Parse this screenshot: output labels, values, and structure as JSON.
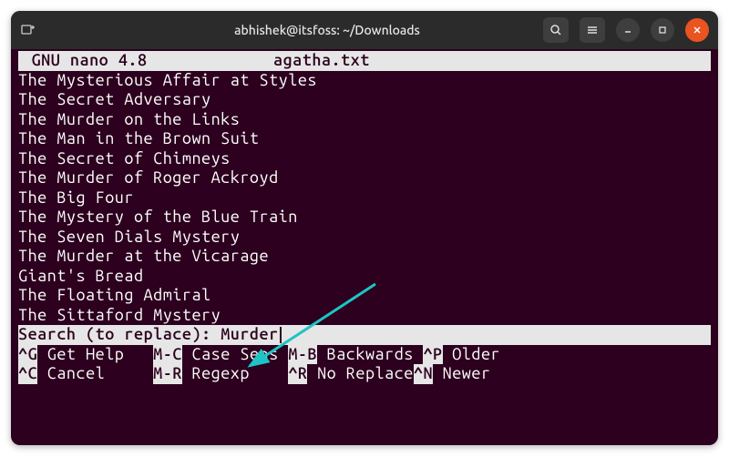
{
  "titlebar": {
    "title": "abhishek@itsfoss: ~/Downloads"
  },
  "editor": {
    "app_name": "GNU nano 4.8",
    "filename": "agatha.txt",
    "lines": [
      "The Mysterious Affair at Styles",
      "The Secret Adversary",
      "The Murder on the Links",
      "The Man in the Brown Suit",
      "The Secret of Chimneys",
      "The Murder of Roger Ackroyd",
      "The Big Four",
      "The Mystery of the Blue Train",
      "The Seven Dials Mystery",
      "The Murder at the Vicarage",
      "Giant's Bread",
      "The Floating Admiral",
      "The Sittaford Mystery"
    ],
    "search_prompt": "Search (to replace): ",
    "search_value": "Murder"
  },
  "shortcuts": {
    "row1": [
      {
        "key": "^G",
        "desc": " Get Help "
      },
      {
        "key": "M-C",
        "desc": " Case Sens"
      },
      {
        "key": "M-B",
        "desc": " Backwards"
      },
      {
        "key": "^P",
        "desc": " Older"
      }
    ],
    "row2": [
      {
        "key": "^C",
        "desc": " Cancel   "
      },
      {
        "key": "M-R",
        "desc": " Regexp   "
      },
      {
        "key": "^R",
        "desc": " No Replace"
      },
      {
        "key": "^N",
        "desc": " Newer"
      }
    ]
  },
  "annotation": {
    "arrow_color": "#1ec4c4"
  }
}
